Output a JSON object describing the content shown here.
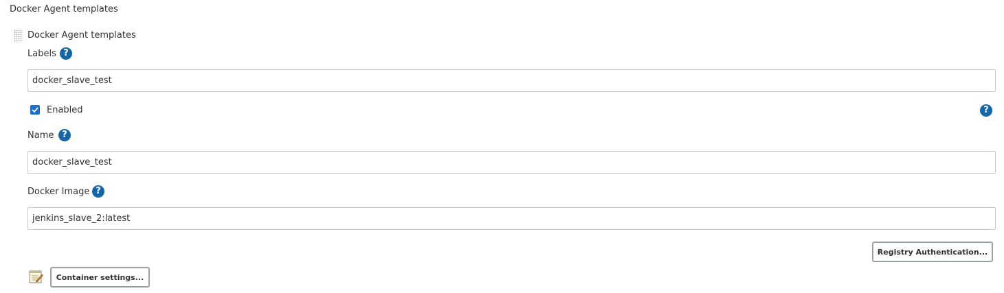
{
  "section": {
    "title": "Docker Agent templates"
  },
  "template": {
    "title": "Docker Agent templates",
    "labels": {
      "label": "Labels",
      "value": "docker_slave_test"
    },
    "enabled": {
      "label": "Enabled",
      "checked": true
    },
    "name": {
      "label": "Name",
      "value": "docker_slave_test"
    },
    "docker_image": {
      "label": "Docker Image",
      "value": "jenkins_slave_2:latest"
    },
    "registry_auth_button": "Registry Authentication...",
    "container_settings_button": "Container settings..."
  },
  "icons": {
    "help": "?",
    "help_color": "#1566a8",
    "checkbox_color": "#1d6fcf"
  }
}
